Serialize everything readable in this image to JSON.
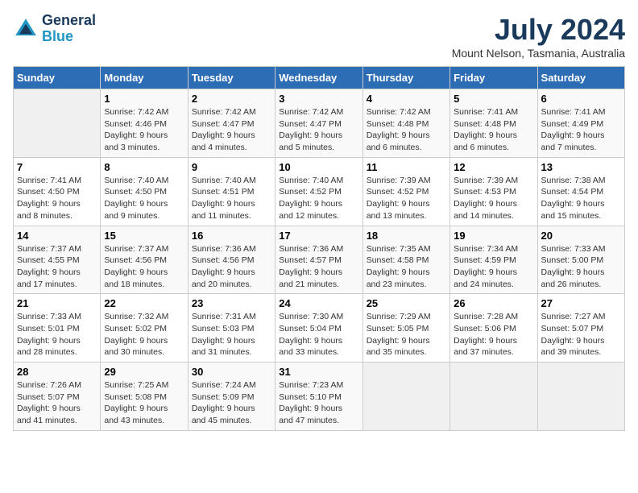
{
  "header": {
    "logo_line1": "General",
    "logo_line2": "Blue",
    "title": "July 2024",
    "subtitle": "Mount Nelson, Tasmania, Australia"
  },
  "columns": [
    "Sunday",
    "Monday",
    "Tuesday",
    "Wednesday",
    "Thursday",
    "Friday",
    "Saturday"
  ],
  "weeks": [
    [
      {
        "day": "",
        "info": ""
      },
      {
        "day": "1",
        "info": "Sunrise: 7:42 AM\nSunset: 4:46 PM\nDaylight: 9 hours\nand 3 minutes."
      },
      {
        "day": "2",
        "info": "Sunrise: 7:42 AM\nSunset: 4:47 PM\nDaylight: 9 hours\nand 4 minutes."
      },
      {
        "day": "3",
        "info": "Sunrise: 7:42 AM\nSunset: 4:47 PM\nDaylight: 9 hours\nand 5 minutes."
      },
      {
        "day": "4",
        "info": "Sunrise: 7:42 AM\nSunset: 4:48 PM\nDaylight: 9 hours\nand 6 minutes."
      },
      {
        "day": "5",
        "info": "Sunrise: 7:41 AM\nSunset: 4:48 PM\nDaylight: 9 hours\nand 6 minutes."
      },
      {
        "day": "6",
        "info": "Sunrise: 7:41 AM\nSunset: 4:49 PM\nDaylight: 9 hours\nand 7 minutes."
      }
    ],
    [
      {
        "day": "7",
        "info": "Sunrise: 7:41 AM\nSunset: 4:50 PM\nDaylight: 9 hours\nand 8 minutes."
      },
      {
        "day": "8",
        "info": "Sunrise: 7:40 AM\nSunset: 4:50 PM\nDaylight: 9 hours\nand 9 minutes."
      },
      {
        "day": "9",
        "info": "Sunrise: 7:40 AM\nSunset: 4:51 PM\nDaylight: 9 hours\nand 11 minutes."
      },
      {
        "day": "10",
        "info": "Sunrise: 7:40 AM\nSunset: 4:52 PM\nDaylight: 9 hours\nand 12 minutes."
      },
      {
        "day": "11",
        "info": "Sunrise: 7:39 AM\nSunset: 4:52 PM\nDaylight: 9 hours\nand 13 minutes."
      },
      {
        "day": "12",
        "info": "Sunrise: 7:39 AM\nSunset: 4:53 PM\nDaylight: 9 hours\nand 14 minutes."
      },
      {
        "day": "13",
        "info": "Sunrise: 7:38 AM\nSunset: 4:54 PM\nDaylight: 9 hours\nand 15 minutes."
      }
    ],
    [
      {
        "day": "14",
        "info": "Sunrise: 7:37 AM\nSunset: 4:55 PM\nDaylight: 9 hours\nand 17 minutes."
      },
      {
        "day": "15",
        "info": "Sunrise: 7:37 AM\nSunset: 4:56 PM\nDaylight: 9 hours\nand 18 minutes."
      },
      {
        "day": "16",
        "info": "Sunrise: 7:36 AM\nSunset: 4:56 PM\nDaylight: 9 hours\nand 20 minutes."
      },
      {
        "day": "17",
        "info": "Sunrise: 7:36 AM\nSunset: 4:57 PM\nDaylight: 9 hours\nand 21 minutes."
      },
      {
        "day": "18",
        "info": "Sunrise: 7:35 AM\nSunset: 4:58 PM\nDaylight: 9 hours\nand 23 minutes."
      },
      {
        "day": "19",
        "info": "Sunrise: 7:34 AM\nSunset: 4:59 PM\nDaylight: 9 hours\nand 24 minutes."
      },
      {
        "day": "20",
        "info": "Sunrise: 7:33 AM\nSunset: 5:00 PM\nDaylight: 9 hours\nand 26 minutes."
      }
    ],
    [
      {
        "day": "21",
        "info": "Sunrise: 7:33 AM\nSunset: 5:01 PM\nDaylight: 9 hours\nand 28 minutes."
      },
      {
        "day": "22",
        "info": "Sunrise: 7:32 AM\nSunset: 5:02 PM\nDaylight: 9 hours\nand 30 minutes."
      },
      {
        "day": "23",
        "info": "Sunrise: 7:31 AM\nSunset: 5:03 PM\nDaylight: 9 hours\nand 31 minutes."
      },
      {
        "day": "24",
        "info": "Sunrise: 7:30 AM\nSunset: 5:04 PM\nDaylight: 9 hours\nand 33 minutes."
      },
      {
        "day": "25",
        "info": "Sunrise: 7:29 AM\nSunset: 5:05 PM\nDaylight: 9 hours\nand 35 minutes."
      },
      {
        "day": "26",
        "info": "Sunrise: 7:28 AM\nSunset: 5:06 PM\nDaylight: 9 hours\nand 37 minutes."
      },
      {
        "day": "27",
        "info": "Sunrise: 7:27 AM\nSunset: 5:07 PM\nDaylight: 9 hours\nand 39 minutes."
      }
    ],
    [
      {
        "day": "28",
        "info": "Sunrise: 7:26 AM\nSunset: 5:07 PM\nDaylight: 9 hours\nand 41 minutes."
      },
      {
        "day": "29",
        "info": "Sunrise: 7:25 AM\nSunset: 5:08 PM\nDaylight: 9 hours\nand 43 minutes."
      },
      {
        "day": "30",
        "info": "Sunrise: 7:24 AM\nSunset: 5:09 PM\nDaylight: 9 hours\nand 45 minutes."
      },
      {
        "day": "31",
        "info": "Sunrise: 7:23 AM\nSunset: 5:10 PM\nDaylight: 9 hours\nand 47 minutes."
      },
      {
        "day": "",
        "info": ""
      },
      {
        "day": "",
        "info": ""
      },
      {
        "day": "",
        "info": ""
      }
    ]
  ]
}
